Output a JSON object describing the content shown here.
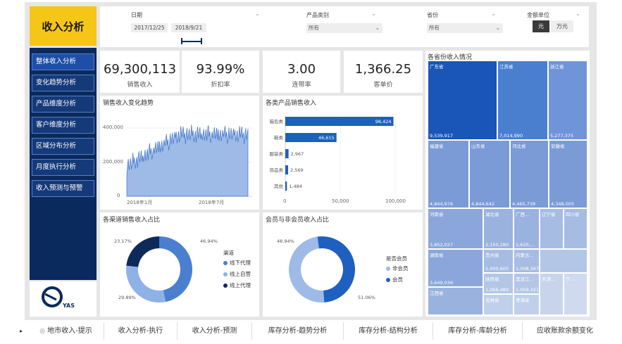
{
  "colors": {
    "primary": "#1f5fc0",
    "mid": "#4a7fd0",
    "light": "#8fb2e6",
    "dark": "#0e2a5a",
    "accent": "#f5c518"
  },
  "app_title": "收入分析",
  "nav": {
    "items": [
      "整体收入分析",
      "变化趋势分析",
      "产品维度分析",
      "客户维度分析",
      "区域分布分析",
      "月度执行分析",
      "收入预测与预警"
    ]
  },
  "logo_text": "YAS",
  "filters": {
    "date": {
      "label": "日期",
      "start": "2017/12/25",
      "end": "2018/9/21"
    },
    "category": {
      "label": "产品类别",
      "value": "所有"
    },
    "province": {
      "label": "省份",
      "value": "所有"
    },
    "unit": {
      "label": "金额单位",
      "options": [
        "元",
        "万元"
      ],
      "selected": "元"
    }
  },
  "kpis": [
    {
      "value": "69,300,113",
      "label": "销售收入"
    },
    {
      "value": "93.99%",
      "label": "折扣率"
    },
    {
      "value": "3.00",
      "label": "连带率"
    },
    {
      "value": "1,366.25",
      "label": "客单价"
    }
  ],
  "line_chart": {
    "title": "销售收入变化趋势",
    "y_ticks": [
      "400,000",
      "200,000",
      "0"
    ],
    "x_ticks": [
      "2018年1月",
      "2018年7月"
    ]
  },
  "bar_chart": {
    "title": "各类产品销售收入",
    "x_ticks": [
      "0",
      "50,000",
      "100,000"
    ]
  },
  "channel_donut": {
    "title": "各渠道销售收入占比",
    "legend_title": "渠道",
    "legend": [
      "线下代理",
      "线上自营",
      "线上代理"
    ],
    "labels": [
      "46.94%",
      "23.17%",
      "29.89%"
    ]
  },
  "member_donut": {
    "title": "会员与非会员收入占比",
    "legend_title": "是否会员",
    "legend": [
      "非会员",
      "会员"
    ],
    "labels": [
      "48.94%",
      "51.06%"
    ]
  },
  "treemap": {
    "title": "各省份收入情况",
    "cells": [
      {
        "name": "广东省",
        "value": "9,539,917"
      },
      {
        "name": "江苏省",
        "value": "7,014,990"
      },
      {
        "name": "浙江省",
        "value": "5,277,375"
      },
      {
        "name": "福建省",
        "value": "4,844,976"
      },
      {
        "name": "山东省",
        "value": "4,844,642"
      },
      {
        "name": "河北省",
        "value": "4,465,738"
      },
      {
        "name": "安徽省",
        "value": "4,348,005"
      },
      {
        "name": "河南省",
        "value": "3,852,027"
      },
      {
        "name": "湖北省",
        "value": "2,150,280"
      },
      {
        "name": "广西...",
        "value": "1,620,..."
      },
      {
        "name": "辽宁省",
        "value": ""
      },
      {
        "name": "四川省",
        "value": ""
      },
      {
        "name": "湖南省",
        "value": "3,649,036"
      },
      {
        "name": "贵州省",
        "value": "1,000,600"
      },
      {
        "name": "内蒙古...",
        "value": "1,008,367"
      },
      {
        "name": "江西省",
        "value": ""
      },
      {
        "name": "陕西省",
        "value": "1,066,489"
      },
      {
        "name": "黑龙江...",
        "value": "1,059,321"
      },
      {
        "name": "吉林省",
        "value": ""
      },
      {
        "name": "青海省",
        "value": ""
      },
      {
        "name": "天津...",
        "value": ""
      },
      {
        "name": "宁...",
        "value": ""
      }
    ]
  },
  "chart_data": [
    {
      "type": "line",
      "title": "销售收入变化趋势",
      "x": [
        "2018年1月",
        "2018年7月"
      ],
      "ylim": [
        0,
        450000
      ],
      "y_ticks": [
        0,
        200000,
        400000
      ]
    },
    {
      "type": "bar",
      "title": "各类产品销售收入",
      "categories": [
        "箱包类",
        "鞋类",
        "服装类",
        "饰品类",
        "其他"
      ],
      "values": [
        98424,
        46615,
        2967,
        2569,
        1484
      ],
      "xlim": [
        0,
        100000
      ]
    },
    {
      "type": "pie",
      "title": "各渠道销售收入占比",
      "categories": [
        "线下代理",
        "线上自营",
        "线上代理"
      ],
      "values": [
        46.94,
        29.89,
        23.17
      ]
    },
    {
      "type": "pie",
      "title": "会员与非会员收入占比",
      "categories": [
        "非会员",
        "会员"
      ],
      "values": [
        48.94,
        51.06
      ]
    }
  ],
  "tabs": [
    "地市收入-提示",
    "收入分析-执行",
    "收入分析-预测",
    "库存分析-趋势分析",
    "库存分析-结构分析",
    "库存分析-库龄分析",
    "应收账款余额变化"
  ]
}
